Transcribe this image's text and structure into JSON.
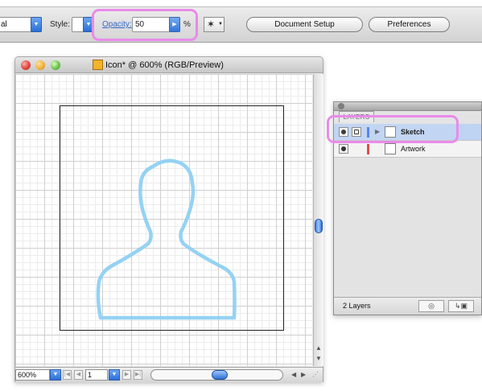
{
  "controlbar": {
    "first_select_value": "al",
    "style_label": "Style:",
    "opacity_label": "Opacity:",
    "opacity_value": "50",
    "percent_symbol": "%",
    "document_setup_button": "Document Setup",
    "preferences_button": "Preferences"
  },
  "document": {
    "title": "Icon* @ 600% (RGB/Preview)",
    "zoom_value": "600%",
    "artboard_value": "1"
  },
  "layers_panel": {
    "tab_label": "LAYERS",
    "count_label": "2 Layers",
    "layers": [
      {
        "name": "Sketch",
        "color": "#4f7ff0",
        "selected": true
      },
      {
        "name": "Artwork",
        "color": "#e34d4d",
        "selected": false
      }
    ]
  },
  "colors": {
    "highlight": "#e88bea",
    "sketch_stroke": "#8fd0f3",
    "selection_row": "#bfd3f3"
  }
}
